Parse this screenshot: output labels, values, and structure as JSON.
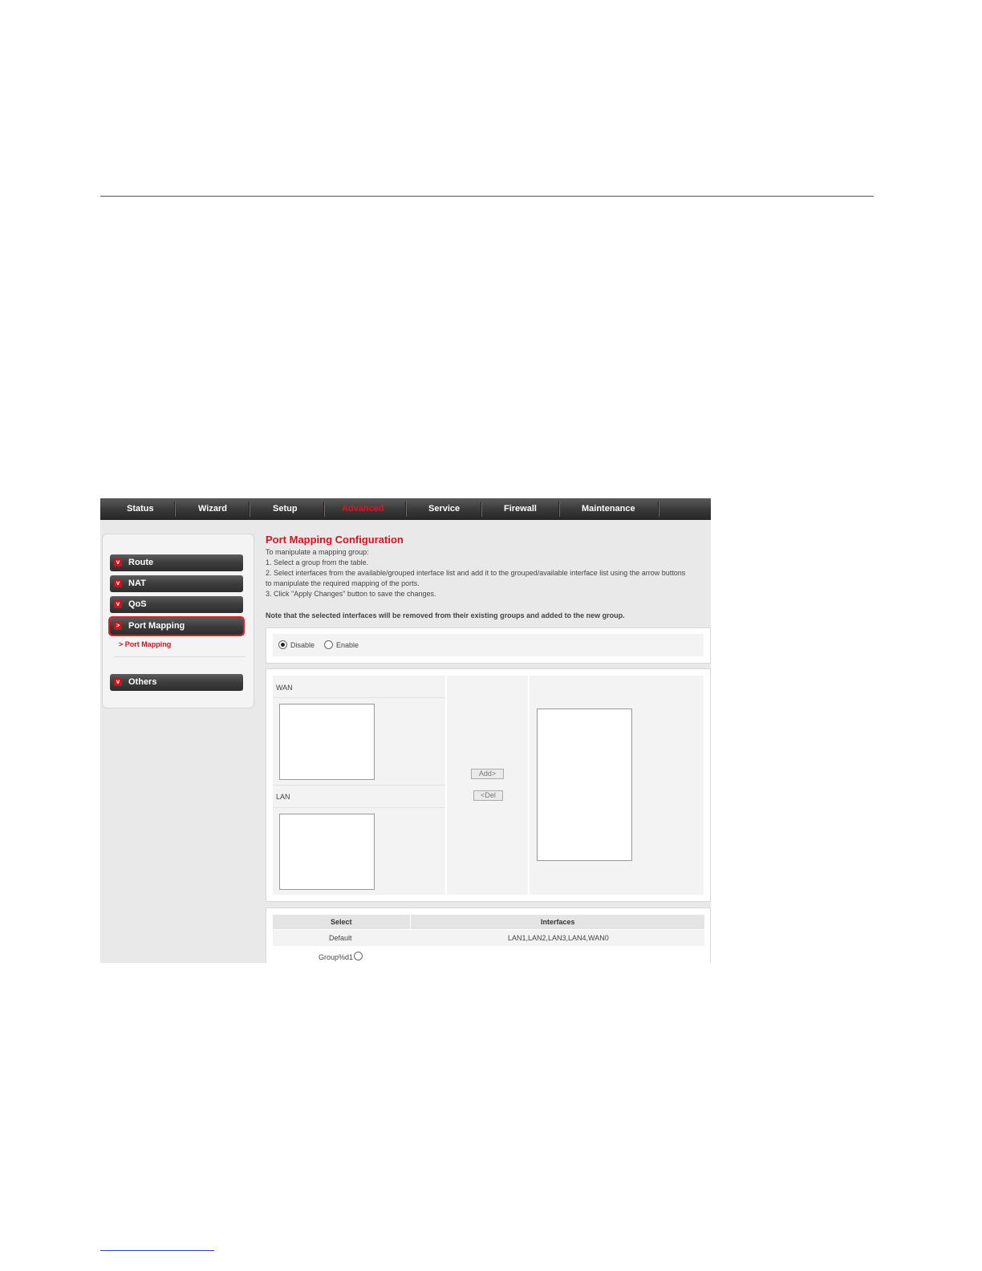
{
  "nav": {
    "items": [
      "Status",
      "Wizard",
      "Setup",
      "Advanced",
      "Service",
      "Firewall",
      "Maintenance"
    ],
    "active": "Advanced"
  },
  "sidebar": {
    "items": [
      "Route",
      "NAT",
      "QoS",
      "Port Mapping",
      "Others"
    ],
    "selected": "Port Mapping",
    "sub_item": "Port Mapping"
  },
  "main": {
    "title": "Port Mapping Configuration",
    "instructions": [
      "To manipulate a mapping group:",
      "1. Select a group from the table.",
      "2. Select interfaces from the available/grouped interface list and add it to the grouped/available interface list using the arrow buttons",
      "to manipulate the required mapping of the ports.",
      "3. Click \"Apply Changes\" button to save the changes."
    ],
    "note": "Note that the selected interfaces will be removed from their existing groups and added to the new group.",
    "mode": {
      "disable_label": "Disable",
      "enable_label": "Enable",
      "selected": "Disable"
    },
    "lists": {
      "wan_label": "WAN",
      "lan_label": "LAN",
      "add_button": "Add>",
      "del_button": "<Del"
    },
    "table": {
      "headers": [
        "Select",
        "Interfaces"
      ],
      "rows": [
        {
          "select": "Default",
          "interfaces": "LAN1,LAN2,LAN3,LAN4,WAN0"
        },
        {
          "select": "Group%d1",
          "interfaces": ""
        }
      ]
    }
  },
  "colors": {
    "accent_red": "#d4141e",
    "nav_dark": "#2e2e2e",
    "page_bg": "#e9e9e9"
  }
}
